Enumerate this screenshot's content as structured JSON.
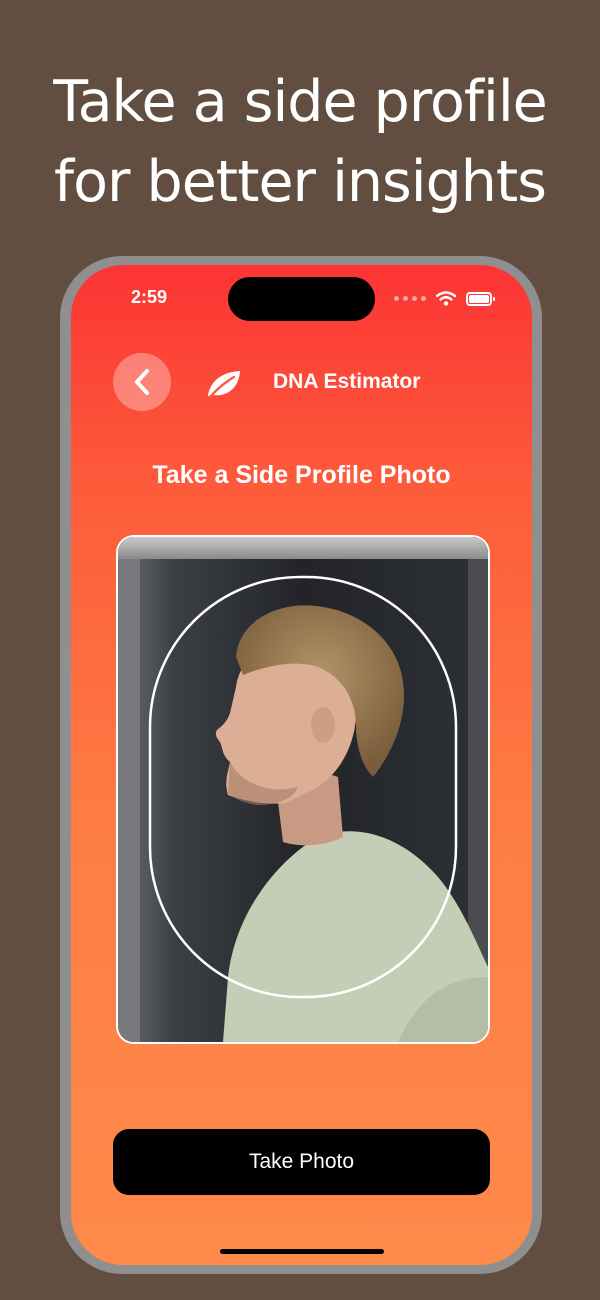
{
  "headline": {
    "line1": "Take a side profile",
    "line2": "for better insights"
  },
  "status_bar": {
    "time": "2:59",
    "icons": [
      "signal-dots-icon",
      "wifi-icon",
      "battery-icon"
    ]
  },
  "nav": {
    "back_icon": "chevron-left-icon",
    "app_icon": "leaf-icon",
    "app_title": "DNA Estimator"
  },
  "main": {
    "title": "Take a Side Profile Photo",
    "preview_description": "camera preview with oval face guide",
    "take_photo_label": "Take Photo"
  },
  "colors": {
    "background": "#624e40",
    "gradient_top": "#fb3434",
    "gradient_bottom": "#ff8a4a",
    "button": "#000000",
    "text": "#ffffff"
  }
}
